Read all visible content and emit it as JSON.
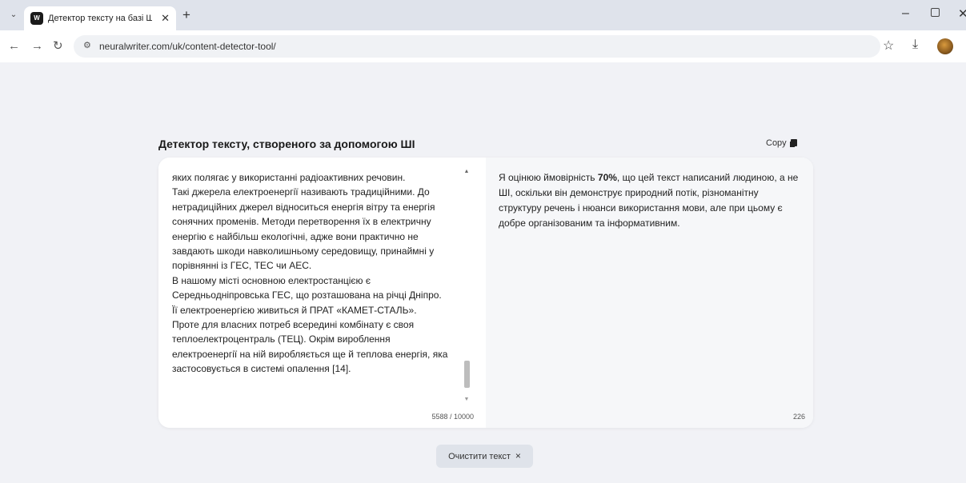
{
  "browser": {
    "tab_title": "Детектор тексту на базі ШІ ▶",
    "tab_favicon": "W",
    "new_tab_glyph": "+",
    "url": "neuralwriter.com/uk/content-detector-tool/"
  },
  "page": {
    "title": "Детектор тексту, створеного за допомогою ШІ",
    "copy_label": "Copy"
  },
  "input": {
    "lines": [
      "яких полягає у використанні радіоактивних речовин.",
      "Такі джерела електроенергії називають традиційними. До",
      "нетрадиційних джерел відноситься енергія вітру та енергія",
      "сонячних променів. Методи перетворення їх в електричну",
      "енергію є найбільш екологічні, адже вони практично не",
      "завдають шкоди навколишньому середовищу, принаймні у",
      "порівнянні із ГЕС, ТЕС чи АЕС.",
      "В нашому місті основною електростанцією є",
      "Середньодніпровська ГЕС, що розташована на річці Дніпро.",
      "Її електроенергією живиться й ПРАТ  «КАМЕТ-СТАЛЬ».",
      "Проте для власних потреб всередині комбінату є своя",
      "теплоелектроцентраль (ТЕЦ). Окрім вироблення",
      "електроенергії на ній виробляється ще й теплова енергія, яка",
      "застосовується в системі опалення [14]."
    ],
    "char_count": "5588 / 10000"
  },
  "result": {
    "prefix": "Я оцінюю ймовірність ",
    "probability": "70%",
    "suffix": ", що цей текст написаний людиною, а не ШІ, оскільки він демонструє природний потік, різноманітну структуру речень і нюанси використання мови, але при цьому є добре організованим та інформативним.",
    "word_count": "226"
  },
  "actions": {
    "clear_label": "Очистити текст",
    "clear_icon": "×"
  }
}
